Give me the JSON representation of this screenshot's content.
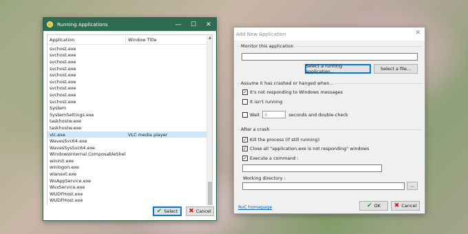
{
  "running_window": {
    "title": "Running Applications",
    "controls": {
      "minimize": "—",
      "maximize": "☐",
      "close": "✕"
    },
    "columns": {
      "application": "Application",
      "window_title": "Window Title"
    },
    "rows": [
      {
        "app": "svchost.exe",
        "title": ""
      },
      {
        "app": "svchost.exe",
        "title": ""
      },
      {
        "app": "svchost.exe",
        "title": ""
      },
      {
        "app": "svchost.exe",
        "title": ""
      },
      {
        "app": "svchost.exe",
        "title": ""
      },
      {
        "app": "svchost.exe",
        "title": ""
      },
      {
        "app": "svchost.exe",
        "title": ""
      },
      {
        "app": "svchost.exe",
        "title": ""
      },
      {
        "app": "svchost.exe",
        "title": ""
      },
      {
        "app": "System",
        "title": ""
      },
      {
        "app": "SystemSettings.exe",
        "title": ""
      },
      {
        "app": "taskhostw.exe",
        "title": ""
      },
      {
        "app": "taskhostw.exe",
        "title": ""
      },
      {
        "app": "vlc.exe",
        "title": "VLC media player"
      },
      {
        "app": "WavesSvc64.exe",
        "title": ""
      },
      {
        "app": "WavesSysSvc64.exe",
        "title": ""
      },
      {
        "app": "WindowsInternal.ComposableShell.E...",
        "title": ""
      },
      {
        "app": "wininit.exe",
        "title": ""
      },
      {
        "app": "winlogon.exe",
        "title": ""
      },
      {
        "app": "wlanext.exe",
        "title": ""
      },
      {
        "app": "WsAppService.exe",
        "title": ""
      },
      {
        "app": "WsxService.exe",
        "title": ""
      },
      {
        "app": "WUDFHost.exe",
        "title": ""
      },
      {
        "app": "WUDFHost.exe",
        "title": ""
      }
    ],
    "selected_row": 13,
    "select_label": "Select",
    "cancel_label": "Cancel"
  },
  "add_window": {
    "title": "Add New Application",
    "close": "✕",
    "monitor": {
      "group_label": "Monitor this application",
      "path_value": "",
      "select_running_label": "Select a running application...",
      "select_file_label": "Select a file..."
    },
    "crash_conditions": {
      "group_label": "Assume it has crashed or hanged when...",
      "not_responding": {
        "label": "It's not responding to Windows messages",
        "checked": true
      },
      "not_running": {
        "label": "It isn't running",
        "checked": false
      },
      "wait": {
        "label": "Wait",
        "checked": false,
        "value": "0",
        "suffix": "seconds and double-check"
      }
    },
    "after_crash": {
      "group_label": "After a crash",
      "kill": {
        "label": "Kill the process (if still running)",
        "checked": true
      },
      "close_dialogs": {
        "label": "Close all \"application.exe is not responding\" windows",
        "checked": true
      },
      "execute": {
        "label": "Execute a command :",
        "checked": true
      },
      "command_value": "",
      "working_dir_label": "Working directory :",
      "working_dir_value": "",
      "browse_label": "..."
    },
    "homepage_link": "RoC homepage",
    "ok_label": "OK",
    "cancel_label": "Cancel"
  },
  "colors": {
    "titlebar": "#2f6a52",
    "selection": "#cce8ff",
    "ok_check": "#2e8b2e",
    "cancel_x": "#c42020",
    "link": "#0b5cad"
  }
}
